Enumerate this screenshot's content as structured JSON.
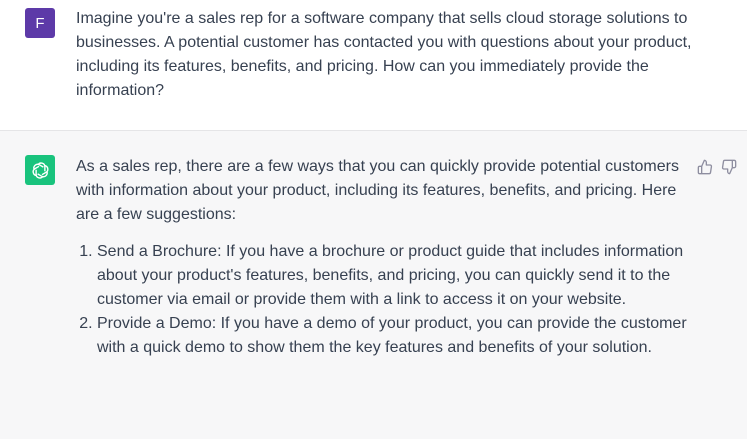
{
  "user_message": {
    "avatar_letter": "F",
    "text": "Imagine you're a sales rep for a software company that sells cloud storage solutions to businesses. A potential customer has contacted you with questions about your product, including its features, benefits, and pricing. How can you immediately provide the information?"
  },
  "assistant_message": {
    "avatar_icon": "openai-logo-icon",
    "intro": "As a sales rep, there are a few ways that you can quickly provide potential customers with information about your product, including its features, benefits, and pricing. Here are a few suggestions:",
    "items": [
      "Send a Brochure: If you have a brochure or product guide that includes information about your product's features, benefits, and pricing, you can quickly send it to the customer via email or provide them with a link to access it on your website.",
      "Provide a Demo: If you have a demo of your product, you can provide the customer with a quick demo to show them the key features and benefits of your solution."
    ],
    "feedback_icons": [
      "thumbs-up-icon",
      "thumbs-down-icon"
    ]
  },
  "colors": {
    "user_avatar": "#5d3aa8",
    "assistant_avatar": "#19c37d",
    "assistant_background": "#f7f7f8",
    "text": "#374151"
  }
}
